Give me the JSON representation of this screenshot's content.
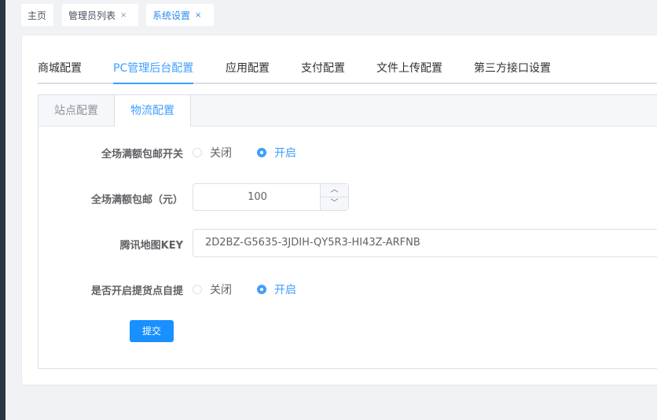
{
  "tags": [
    {
      "label": "主页",
      "closable": false
    },
    {
      "label": "管理员列表",
      "closable": true
    },
    {
      "label": "系统设置",
      "closable": true,
      "active": true
    }
  ],
  "close_glyph": "×",
  "tabs": [
    "商城配置",
    "PC管理后台配置",
    "应用配置",
    "支付配置",
    "文件上传配置",
    "第三方接口设置"
  ],
  "active_tab": "PC管理后台配置",
  "subtabs": [
    "站点配置",
    "物流配置"
  ],
  "active_subtab": "物流配置",
  "form": {
    "free_shipping_switch": {
      "label": "全场满额包邮开关",
      "options": [
        "关闭",
        "开启"
      ],
      "selected": "开启"
    },
    "free_shipping_amount": {
      "label": "全场满额包邮（元）",
      "value": "100"
    },
    "map_key": {
      "label": "腾讯地图KEY",
      "value": "2D2BZ-G5635-3JDIH-QY5R3-HI43Z-ARFNB"
    },
    "pickup_switch": {
      "label": "是否开启提货点自提",
      "options": [
        "关闭",
        "开启"
      ],
      "selected": "开启"
    },
    "submit_label": "提交"
  },
  "colors": {
    "accent": "#409eff",
    "submit": "#1890ff",
    "sidebar": "#2b3643",
    "background": "#f0f2f5"
  }
}
